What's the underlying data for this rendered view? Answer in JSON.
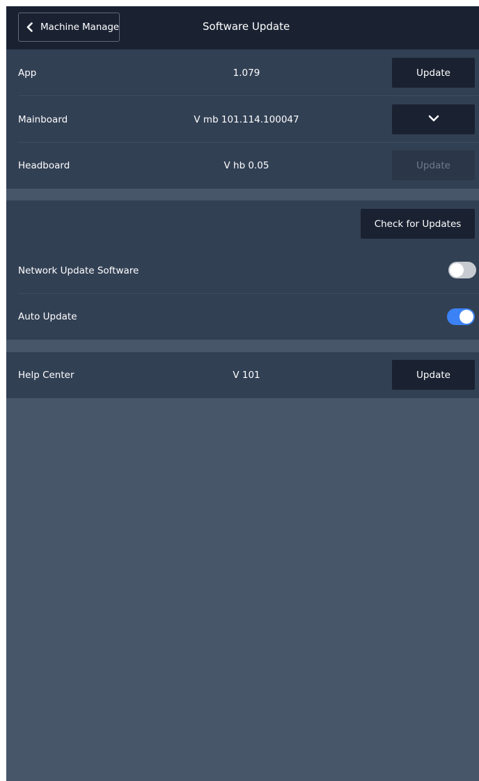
{
  "header": {
    "back_label": "Machine Manage",
    "title": "Software Update"
  },
  "firmware": {
    "app": {
      "name": "App",
      "version": "1.079",
      "button": "Update"
    },
    "mainboard": {
      "name": "Mainboard",
      "version": "V mb 101.114.100047"
    },
    "headboard": {
      "name": "Headboard",
      "version": "V hb 0.05",
      "button": "Update"
    }
  },
  "settings": {
    "check_button": "Check for Updates",
    "network_update": {
      "label": "Network Update Software",
      "enabled": false
    },
    "auto_update": {
      "label": "Auto Update",
      "enabled": true
    }
  },
  "help_center": {
    "name": "Help Center",
    "version": "V 101",
    "button": "Update"
  },
  "colors": {
    "header_bg": "#1a2232",
    "section_bg": "#324054",
    "page_bg": "#475669",
    "toggle_on": "#3b82f6",
    "toggle_off": "#c7cbd1"
  }
}
